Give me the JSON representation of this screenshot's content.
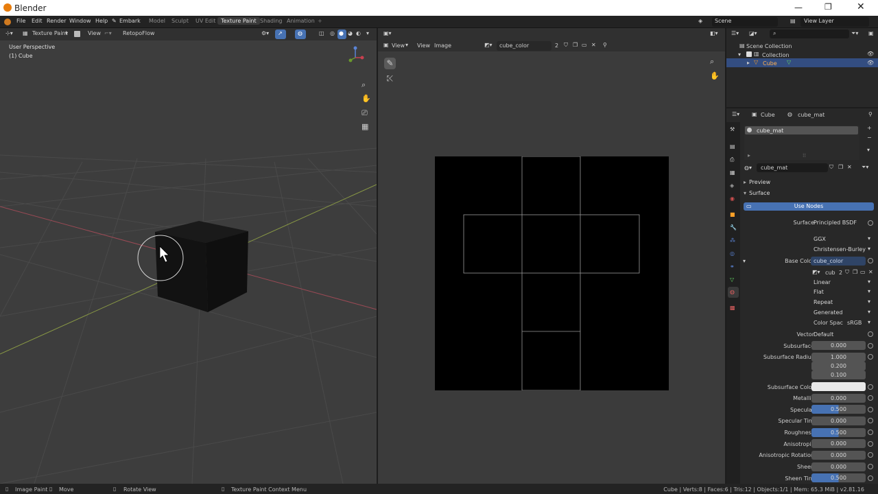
{
  "titlebar": {
    "app_title": "Blender"
  },
  "topbar": {
    "menus": [
      "File",
      "Edit",
      "Render",
      "Window",
      "Help",
      "Embark"
    ],
    "workspaces": [
      "Model",
      "Sculpt",
      "UV Edit",
      "Texture Paint",
      "Shading",
      "Animation"
    ],
    "active_workspace": "Texture Paint",
    "scene": "Scene",
    "view_layer": "View Layer"
  },
  "viewport": {
    "mode": "Texture Paint",
    "view_menu": "View",
    "addon": "RetopoFlow",
    "overlay_title": "User Perspective",
    "overlay_object": "(1) Cube"
  },
  "image_editor": {
    "menu_view": "View",
    "menu_view2": "View",
    "menu_image": "Image",
    "image_name": "cube_color",
    "users": "2"
  },
  "outliner": {
    "scene_collection": "Scene Collection",
    "collection": "Collection",
    "object": "Cube"
  },
  "properties": {
    "object": "Cube",
    "material": "cube_mat",
    "slot": "cube_mat",
    "material_field": "cube_mat",
    "panels": {
      "preview": "Preview",
      "surface": "Surface"
    },
    "use_nodes": "Use Nodes",
    "surface_label": "Surface",
    "surface_value": "Principled BSDF",
    "distribution": "GGX",
    "subsurface_method": "Christensen-Burley",
    "base_color_label": "Base Color",
    "base_color_value": "cube_color",
    "image_short": "cub",
    "image_users": "2",
    "interpolation": "Linear",
    "projection": "Flat",
    "extension": "Repeat",
    "source": "Generated",
    "color_space_label": "Color Spac",
    "color_space_value": "sRGB",
    "vector_label": "Vector",
    "vector_value": "Default",
    "subsurface_label": "Subsurface",
    "subsurface": "0.000",
    "subsurface_radius_label": "Subsurface Radius",
    "subsurface_radius": [
      "1.000",
      "0.200",
      "0.100"
    ],
    "subsurface_color_label": "Subsurface Color",
    "metallic_label": "Metallic",
    "metallic": "0.000",
    "specular_label": "Specular",
    "specular": "0.500",
    "specular_tint_label": "Specular Tint",
    "specular_tint": "0.000",
    "roughness_label": "Roughness",
    "roughness": "0.500",
    "anisotropic_label": "Anisotropic",
    "anisotropic": "0.000",
    "anisotropic_rotation_label": "Anisotropic Rotation",
    "anisotropic_rotation": "0.000",
    "sheen_label": "Sheen",
    "sheen": "0.000",
    "sheen_tint_label": "Sheen Tint",
    "sheen_tint": "0.500"
  },
  "statusbar": {
    "left_hint": "Image Paint",
    "move": "Move",
    "rotate": "Rotate View",
    "context_menu": "Texture Paint Context Menu",
    "stats": "Cube | Verts:8 | Faces:6 | Tris:12 | Objects:1/1 | Mem: 65.3 MiB | v2.81.16"
  },
  "colors": {
    "accent": "#4772b3",
    "active_object": "#ffa028",
    "background": "#3d3d3d"
  }
}
